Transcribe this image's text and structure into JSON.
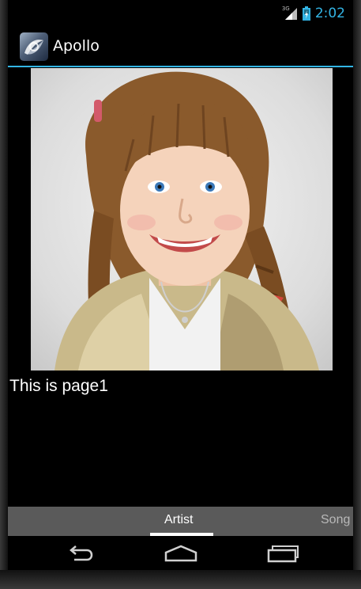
{
  "status_bar": {
    "network_type": "3G",
    "time": "2:02",
    "icons": [
      "signal-icon",
      "battery-icon"
    ]
  },
  "action_bar": {
    "title": "Apollo",
    "icon": "apollo-app-icon",
    "accent_color": "#33b5e5"
  },
  "content": {
    "image": "photo of smiling girl with braided hair",
    "text": "This is page1"
  },
  "tabs": {
    "items": [
      {
        "label": "Artist",
        "selected": true
      },
      {
        "label": "Song",
        "selected": false
      }
    ]
  },
  "nav_bar": {
    "buttons": [
      "back-icon",
      "home-icon",
      "recent-apps-icon"
    ]
  }
}
